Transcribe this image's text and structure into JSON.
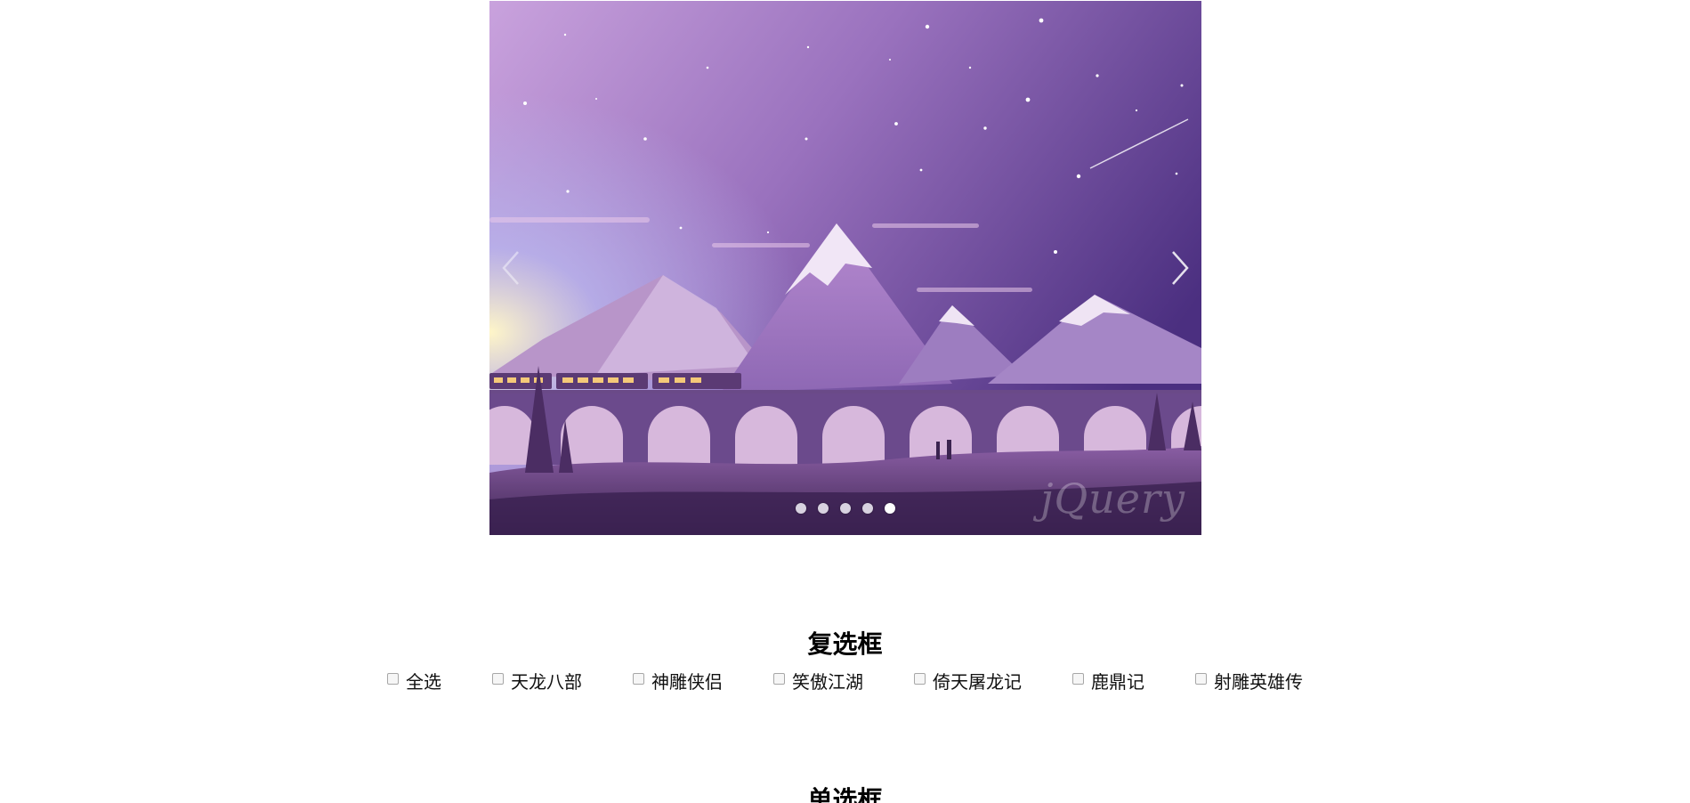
{
  "carousel": {
    "watermark": "jQuery",
    "slide_count": 5,
    "active_index": 4
  },
  "checkbox_section": {
    "title": "复选框",
    "options": [
      {
        "label": "全选",
        "checked": false
      },
      {
        "label": "天龙八部",
        "checked": false
      },
      {
        "label": "神雕侠侣",
        "checked": false
      },
      {
        "label": "笑傲江湖",
        "checked": false
      },
      {
        "label": "倚天屠龙记",
        "checked": false
      },
      {
        "label": "鹿鼎记",
        "checked": false
      },
      {
        "label": "射雕英雄传",
        "checked": false
      }
    ]
  },
  "radio_section": {
    "title": "单选框"
  }
}
